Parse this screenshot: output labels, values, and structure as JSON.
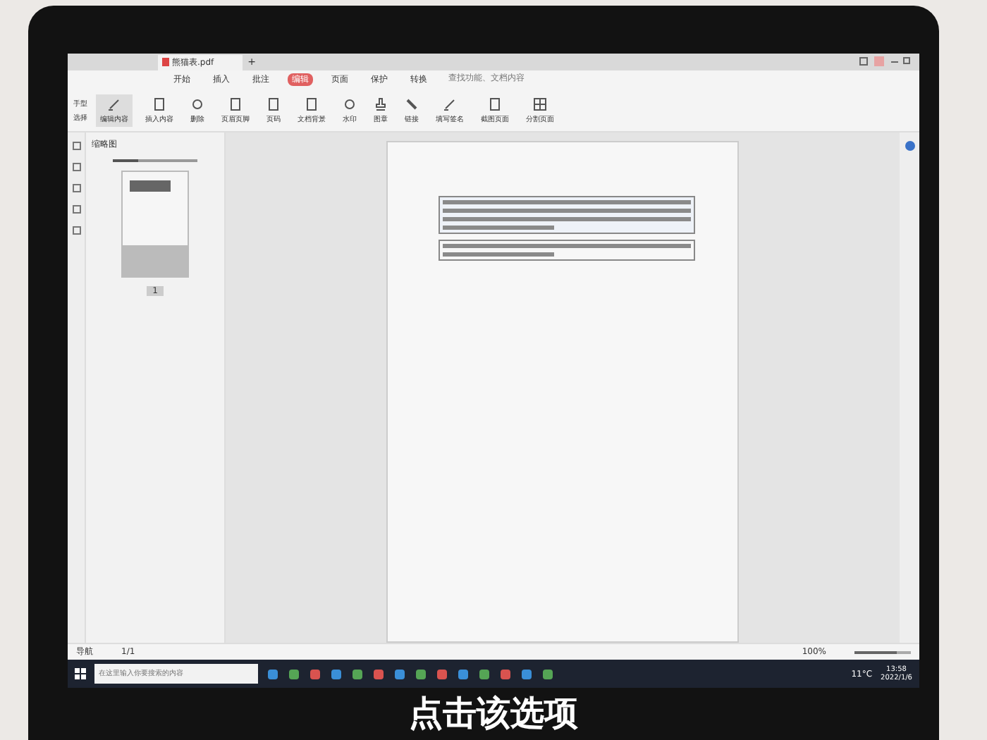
{
  "tab_bar": {
    "file_tab": "熊猫表.pdf",
    "new_tab": "+"
  },
  "menu": {
    "items": [
      {
        "label": "开始",
        "selected": false
      },
      {
        "label": "插入",
        "selected": false
      },
      {
        "label": "批注",
        "selected": false
      },
      {
        "label": "编辑",
        "selected": true
      },
      {
        "label": "页面",
        "selected": false
      },
      {
        "label": "保护",
        "selected": false
      },
      {
        "label": "转换",
        "selected": false
      }
    ],
    "search": {
      "placeholder": "查找功能、文档内容"
    }
  },
  "toolbar": {
    "small": [
      "手型",
      "选择"
    ],
    "buttons": [
      {
        "label": "编辑内容",
        "selected": true
      },
      {
        "label": "插入内容",
        "selected": false
      },
      {
        "label": "删除",
        "selected": false
      },
      {
        "label": "页眉页脚",
        "selected": false
      },
      {
        "label": "页码",
        "selected": false
      },
      {
        "label": "文档背景",
        "selected": false
      },
      {
        "label": "水印",
        "selected": false
      },
      {
        "label": "图章",
        "selected": false
      },
      {
        "label": "链接",
        "selected": false
      },
      {
        "label": "填写签名",
        "selected": false
      },
      {
        "label": "截图页面",
        "selected": false
      },
      {
        "label": "分割页面",
        "selected": false
      }
    ]
  },
  "sidebar": {
    "title": "缩略图",
    "level": 0.3,
    "thumbnail_label": "1"
  },
  "status_bar": {
    "nav": "导航",
    "page": "1/1",
    "zoom": "100%",
    "level": 0.75
  },
  "taskbar": {
    "search": {
      "placeholder": "在这里输入你要搜索的内容"
    },
    "temperature": "11°C",
    "time": "13:58",
    "date": "2022/1/6"
  },
  "caption": "点击该选项"
}
